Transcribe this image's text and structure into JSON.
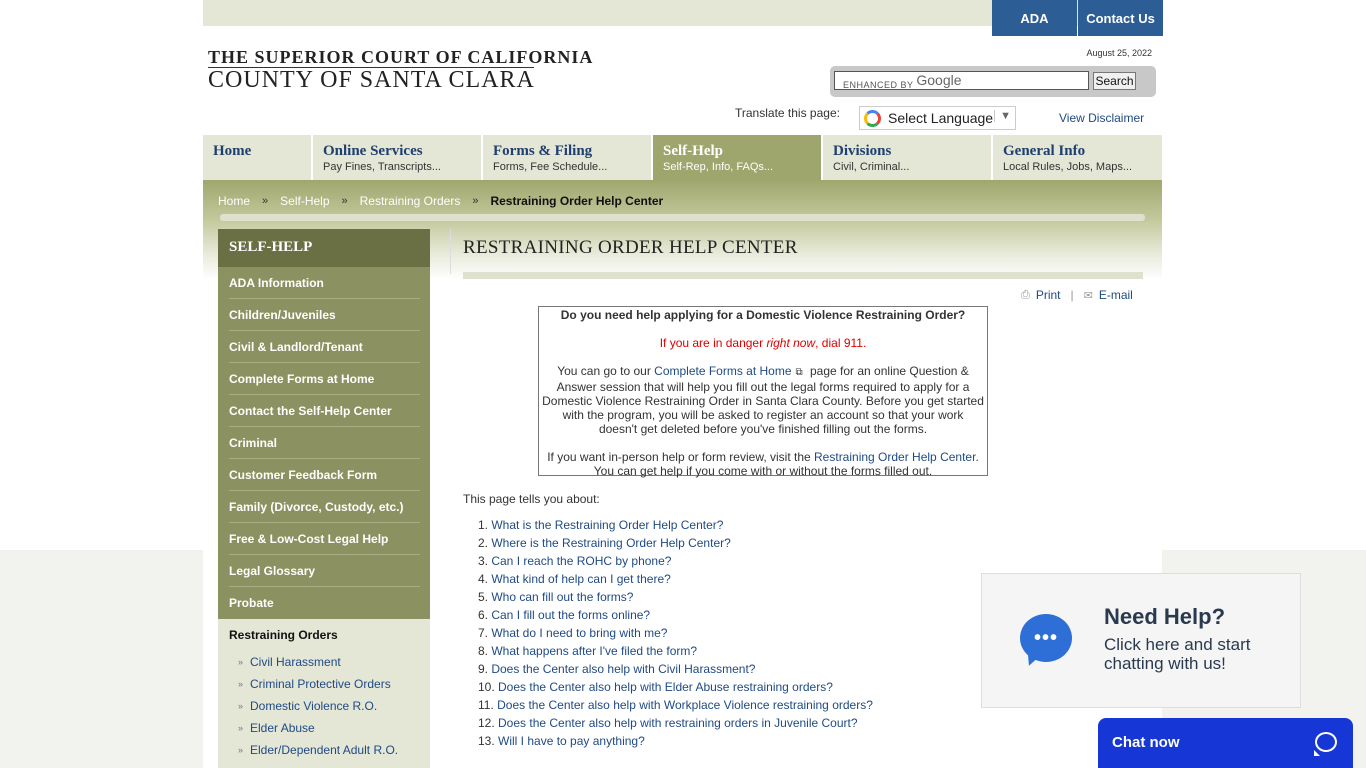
{
  "topbar": {
    "ada_label": "ADA",
    "contact_label": "Contact Us"
  },
  "logo": {
    "line1": "THE SUPERIOR COURT OF CALIFORNIA",
    "line2": "COUNTY OF SANTA CLARA"
  },
  "date": "August 25, 2022",
  "search": {
    "placeholder": "ENHANCED BY",
    "google": "Google",
    "button": "Search"
  },
  "translate": {
    "label": "Translate this page:",
    "select_value": "Select Language",
    "disclaimer": "View Disclaimer"
  },
  "nav": [
    {
      "title": "Home",
      "sub": ""
    },
    {
      "title": "Online Services",
      "sub": "Pay Fines, Transcripts..."
    },
    {
      "title": "Forms & Filing",
      "sub": "Forms, Fee Schedule..."
    },
    {
      "title": "Self-Help",
      "sub": "Self-Rep, Info, FAQs..."
    },
    {
      "title": "Divisions",
      "sub": "Civil, Criminal..."
    },
    {
      "title": "General Info",
      "sub": "Local Rules, Jobs, Maps..."
    }
  ],
  "breadcrumb": {
    "items": [
      "Home",
      "Self-Help",
      "Restraining Orders"
    ],
    "current": "Restraining Order Help Center",
    "sep": "»"
  },
  "sidebar": {
    "heading": "SELF-HELP",
    "items": [
      "ADA Information",
      "Children/Juveniles",
      "Civil & Landlord/Tenant",
      "Complete Forms at Home",
      "Contact the Self-Help Center",
      "Criminal",
      "Customer Feedback Form",
      "Family (Divorce, Custody, etc.)",
      "Free & Low-Cost Legal Help",
      "Legal Glossary",
      "Probate"
    ],
    "current": "Restraining Orders",
    "sub_items": [
      "Civil Harassment",
      "Criminal Protective Orders",
      "Domestic Violence R.O.",
      "Elder Abuse",
      "Elder/Dependent Adult R.O."
    ]
  },
  "main": {
    "title": "RESTRAINING ORDER HELP CENTER",
    "print": "Print",
    "email": "E-mail",
    "notice": {
      "question": "Do you need help applying for a Domestic Violence Restraining Order?",
      "danger_pre": "If you are in danger ",
      "danger_em": "right now",
      "danger_post": ", dial 911.",
      "p1_pre": "You can go to our ",
      "p1_link": "Complete Forms at Home",
      "p1_post": " page for an online Question & Answer session that will help you fill out the legal forms required to apply for a Domestic Violence Restraining Order in Santa Clara County. Before you get started with the program, you will be asked to register an account so that your work doesn't get deleted before you've finished filling out the forms.",
      "p2_pre": "If you want in-person help or form review, visit the ",
      "p2_link": "Restraining Order Help Center",
      "p2_post": ". You can get help if you come with or without the forms filled out."
    },
    "intro": "This page tells you about:",
    "toc": [
      "What is the Restraining Order Help Center?",
      "Where is the Restraining Order Help Center?",
      "Can I reach the ROHC by phone?",
      "What kind of help can I get there?",
      "Who can fill out the forms?",
      "Can I fill out the forms online?",
      "What do I need to bring with me?",
      "What happens after I've filed the form?",
      "Does the Center also help with Civil Harassment?",
      "Does the Center also help with Elder Abuse restraining orders?",
      "Does the Center also help with Workplace Violence restraining orders?",
      "Does the Center also help with restraining orders in Juvenile Court?",
      "Will I have to pay anything?"
    ]
  },
  "help_widget": {
    "title": "Need Help?",
    "text": "Click here and start chatting with us!"
  },
  "chat": {
    "label": "Chat now"
  },
  "colors": {
    "nav_active": "#9fa66d",
    "sidebar_green": "#8b9160",
    "button_blue": "#2d5d95",
    "chat_blue": "#1636d6"
  }
}
